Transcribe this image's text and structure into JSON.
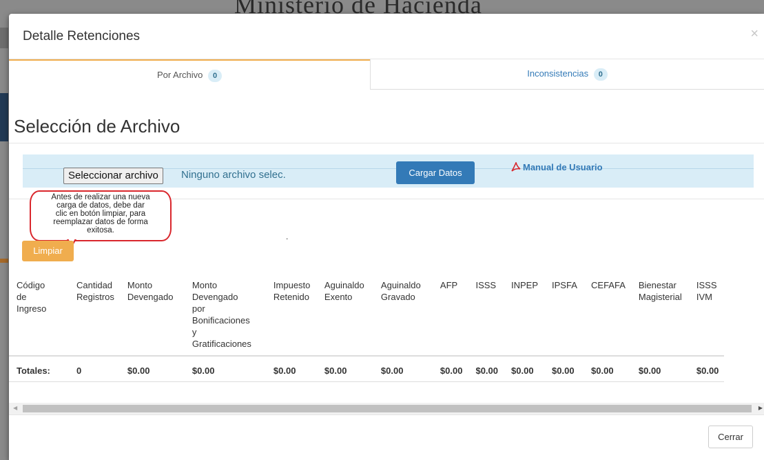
{
  "background": {
    "title": "Ministerio de Hacienda"
  },
  "modal": {
    "title": "Detalle Retenciones",
    "close_glyph": "×",
    "tabs": [
      {
        "label": "Por Archivo",
        "badge": "0"
      },
      {
        "label": "Inconsistencias",
        "badge": "0"
      }
    ],
    "section_title": "Selección de Archivo",
    "upload": {
      "file_button": "Seleccionar archivo",
      "file_status": "Ninguno archivo selec.",
      "load_button": "Cargar Datos",
      "manual_link": "Manual de Usuario"
    },
    "tooltip": {
      "lines": [
        "Antes de realizar una nueva",
        "carga de datos, debe dar",
        "clic en botón limpiar, para",
        "reemplazar datos de forma",
        "exitosa."
      ]
    },
    "dot": ".",
    "clear_button": "Limpiar",
    "table": {
      "headers": [
        [
          "Código",
          "de",
          "Ingreso"
        ],
        [
          "Cantidad",
          "Registros"
        ],
        [
          "Monto",
          "Devengado"
        ],
        [
          "Monto",
          "Devengado",
          "por",
          "Bonificaciones",
          "y",
          "Gratificaciones"
        ],
        [
          "Impuesto",
          "Retenido"
        ],
        [
          "Aguinaldo",
          "Exento"
        ],
        [
          "Aguinaldo",
          "Gravado"
        ],
        [
          "AFP"
        ],
        [
          "ISSS"
        ],
        [
          "INPEP"
        ],
        [
          "IPSFA"
        ],
        [
          "CEFAFA"
        ],
        [
          "Bienestar",
          "Magisterial"
        ],
        [
          "ISSS",
          "IVM"
        ]
      ],
      "totals": [
        "Totales:",
        "0",
        "$0.00",
        "$0.00",
        "$0.00",
        "$0.00",
        "$0.00",
        "$0.00",
        "$0.00",
        "$0.00",
        "$0.00",
        "$0.00",
        "$0.00",
        "$0.00"
      ]
    },
    "footer": {
      "close_button": "Cerrar"
    }
  }
}
